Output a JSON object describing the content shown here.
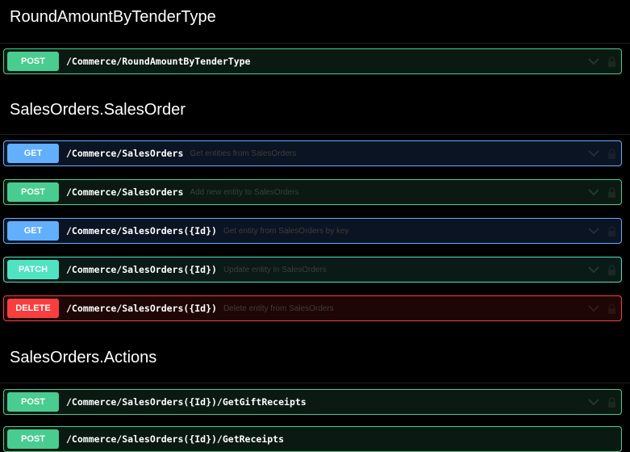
{
  "sections": [
    {
      "title": "RoundAmountByTenderType",
      "operations": [
        {
          "method": "POST",
          "path": "/Commerce/RoundAmountByTenderType",
          "summary": ""
        }
      ]
    },
    {
      "title": "SalesOrders.SalesOrder",
      "operations": [
        {
          "method": "GET",
          "path": "/Commerce/SalesOrders",
          "summary": "Get entities from SalesOrders"
        },
        {
          "method": "POST",
          "path": "/Commerce/SalesOrders",
          "summary": "Add new entity to SalesOrders"
        },
        {
          "method": "GET",
          "path": "/Commerce/SalesOrders({Id})",
          "summary": "Get entity from SalesOrders by key"
        },
        {
          "method": "PATCH",
          "path": "/Commerce/SalesOrders({Id})",
          "summary": "Update entity in SalesOrders"
        },
        {
          "method": "DELETE",
          "path": "/Commerce/SalesOrders({Id})",
          "summary": "Delete entity from SalesOrders"
        }
      ]
    },
    {
      "title": "SalesOrders.Actions",
      "operations": [
        {
          "method": "POST",
          "path": "/Commerce/SalesOrders({Id})/GetGiftReceipts",
          "summary": ""
        },
        {
          "method": "POST",
          "path": "/Commerce/SalesOrders({Id})/GetReceipts",
          "summary": ""
        }
      ]
    }
  ],
  "icons": {
    "expand": "chevron-down-icon",
    "auth": "lock-icon"
  },
  "colors": {
    "post": "#49cc90",
    "get": "#61affe",
    "patch": "#50e3c2",
    "delete": "#f93e3e",
    "background": "#000000"
  }
}
